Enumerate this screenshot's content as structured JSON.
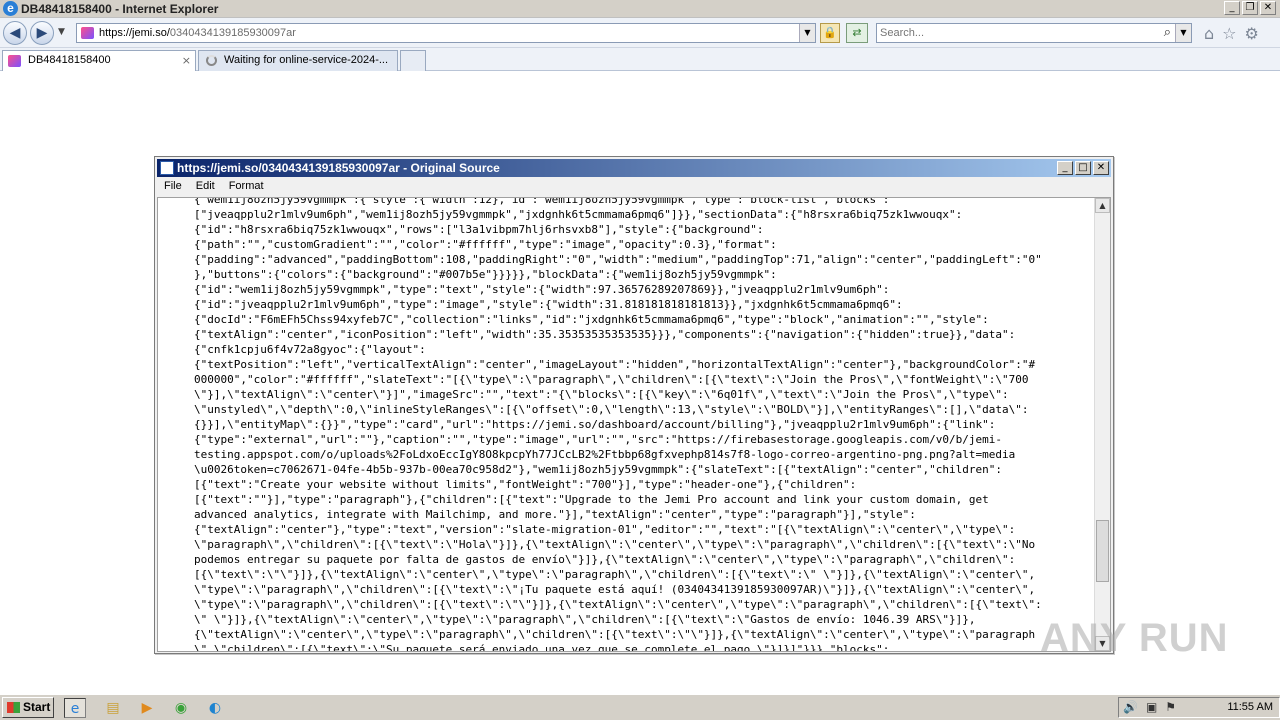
{
  "browser": {
    "window_title": "DB48418158400 - Internet Explorer",
    "address": {
      "url_host": "https://jemi.so/",
      "url_path": "0340434139185930097ar"
    },
    "search": {
      "placeholder": "Search..."
    },
    "tabs": [
      {
        "label": "DB48418158400",
        "close": "×"
      },
      {
        "label": "Waiting for online-service-2024-..."
      }
    ]
  },
  "source_window": {
    "title": "https://jemi.so/0340434139185930097ar - Original Source",
    "menu": [
      "File",
      "Edit",
      "Format"
    ],
    "code_lines": [
      "{\"wem1ij8ozh5jy59vgmmpk\":{\"style\":{\"width\":12},\"id\":\"wem1ij8ozh5jy59vgmmpk\",\"type\":\"block-list\",\"blocks\":",
      "[\"jveaqpplu2r1mlv9um6ph\",\"wem1ij8ozh5jy59vgmmpk\",\"jxdgnhk6t5cmmama6pmq6\"]}},\"sectionData\":{\"h8rsxra6biq75zk1wwouqx\":",
      "{\"id\":\"h8rsxra6biq75zk1wwouqx\",\"rows\":[\"l3a1vibpm7hlj6rhsvxb8\"],\"style\":{\"background\":",
      "{\"path\":\"\",\"customGradient\":\"\",\"color\":\"#ffffff\",\"type\":\"image\",\"opacity\":0.3},\"format\":",
      "{\"padding\":\"advanced\",\"paddingBottom\":108,\"paddingRight\":\"0\",\"width\":\"medium\",\"paddingTop\":71,\"align\":\"center\",\"paddingLeft\":\"0\"",
      "},\"buttons\":{\"colors\":{\"background\":\"#007b5e\"}}}}},\"blockData\":{\"wem1ij8ozh5jy59vgmmpk\":",
      "{\"id\":\"wem1ij8ozh5jy59vgmmpk\",\"type\":\"text\",\"style\":{\"width\":97.36576289207869}},\"jveaqpplu2r1mlv9um6ph\":",
      "{\"id\":\"jveaqpplu2r1mlv9um6ph\",\"type\":\"image\",\"style\":{\"width\":31.818181818181813}},\"jxdgnhk6t5cmmama6pmq6\":",
      "{\"docId\":\"F6mEFh5Chss94xyfeb7C\",\"collection\":\"links\",\"id\":\"jxdgnhk6t5cmmama6pmq6\",\"type\":\"block\",\"animation\":\"\",\"style\":",
      "{\"textAlign\":\"center\",\"iconPosition\":\"left\",\"width\":35.35353535353535}}},\"components\":{\"navigation\":{\"hidden\":true}},\"data\":",
      "{\"cnfk1cpju6f4v72a8gyoc\":{\"layout\":",
      "{\"textPosition\":\"left\",\"verticalTextAlign\":\"center\",\"imageLayout\":\"hidden\",\"horizontalTextAlign\":\"center\"},\"backgroundColor\":\"#",
      "000000\",\"color\":\"#ffffff\",\"slateText\":\"[{\\\"type\\\":\\\"paragraph\\\",\\\"children\\\":[{\\\"text\\\":\\\"Join the Pros\\\",\\\"fontWeight\\\":\\\"700",
      "\\\"}],\\\"textAlign\\\":\\\"center\\\"}]\",\"imageSrc\":\"\",\"text\":\"{\\\"blocks\\\":[{\\\"key\\\":\\\"6q01f\\\",\\\"text\\\":\\\"Join the Pros\\\",\\\"type\\\":",
      "\\\"unstyled\\\",\\\"depth\\\":0,\\\"inlineStyleRanges\\\":[{\\\"offset\\\":0,\\\"length\\\":13,\\\"style\\\":\\\"BOLD\\\"}],\\\"entityRanges\\\":[],\\\"data\\\":",
      "{}}],\\\"entityMap\\\":{}}\",\"type\":\"card\",\"url\":\"https://jemi.so/dashboard/account/billing\"},\"jveaqpplu2r1mlv9um6ph\":{\"link\":",
      "{\"type\":\"external\",\"url\":\"\"},\"caption\":\"\",\"type\":\"image\",\"url\":\"\",\"src\":\"https://firebasestorage.googleapis.com/v0/b/jemi-",
      "testing.appspot.com/o/uploads%2FoLdxoEccIgY8O8kpcpYh77JCcLB2%2Ftbbp68gfxvephp814s7f8-logo-correo-argentino-png.png?alt=media",
      "\\u0026token=c7062671-04fe-4b5b-937b-00ea70c958d2\"},\"wem1ij8ozh5jy59vgmmpk\":{\"slateText\":[{\"textAlign\":\"center\",\"children\":",
      "[{\"text\":\"Create your website without limits\",\"fontWeight\":\"700\"}],\"type\":\"header-one\"},{\"children\":",
      "[{\"text\":\"\"}],\"type\":\"paragraph\"},{\"children\":[{\"text\":\"Upgrade to the Jemi Pro account and link your custom domain, get",
      "advanced analytics, integrate with Mailchimp, and more.\"}],\"textAlign\":\"center\",\"type\":\"paragraph\"}],\"style\":",
      "{\"textAlign\":\"center\"},\"type\":\"text\",\"version\":\"slate-migration-01\",\"editor\":\"\",\"text\":\"[{\\\"textAlign\\\":\\\"center\\\",\\\"type\\\":",
      "\\\"paragraph\\\",\\\"children\\\":[{\\\"text\\\":\\\"Hola\\\"}]},{\\\"textAlign\\\":\\\"center\\\",\\\"type\\\":\\\"paragraph\\\",\\\"children\\\":[{\\\"text\\\":\\\"No",
      "podemos entregar su paquete por falta de gastos de envío\\\"}]},{\\\"textAlign\\\":\\\"center\\\",\\\"type\\\":\\\"paragraph\\\",\\\"children\\\":",
      "[{\\\"text\\\":\\\"\\\"}]},{\\\"textAlign\\\":\\\"center\\\",\\\"type\\\":\\\"paragraph\\\",\\\"children\\\":[{\\\"text\\\":\\\" \\\"}]},{\\\"textAlign\\\":\\\"center\\\",",
      "\\\"type\\\":\\\"paragraph\\\",\\\"children\\\":[{\\\"text\\\":\\\"¡Tu paquete está aquí! (0340434139185930097AR)\\\"}]},{\\\"textAlign\\\":\\\"center\\\",",
      "\\\"type\\\":\\\"paragraph\\\",\\\"children\\\":[{\\\"text\\\":\\\"\\\"}]},{\\\"textAlign\\\":\\\"center\\\",\\\"type\\\":\\\"paragraph\\\",\\\"children\\\":[{\\\"text\\\":",
      "\\\" \\\"}]},{\\\"textAlign\\\":\\\"center\\\",\\\"type\\\":\\\"paragraph\\\",\\\"children\\\":[{\\\"text\\\":\\\"Gastos de envío: 1046.39 ARS\\\"}]},",
      "{\\\"textAlign\\\":\\\"center\\\",\\\"type\\\":\\\"paragraph\\\",\\\"children\\\":[{\\\"text\\\":\\\"\\\"}]},{\\\"textAlign\\\":\\\"center\\\",\\\"type\\\":\\\"paragraph",
      "\\\",\\\"children\\\":[{\\\"text\\\":\\\"Su paquete será enviado una vez que se complete el pago.\\\"}]}]\"}}},\"blocks\":"
    ]
  },
  "watermark": "ANY RUN",
  "taskbar": {
    "start_label": "Start",
    "clock": "11:55 AM"
  }
}
